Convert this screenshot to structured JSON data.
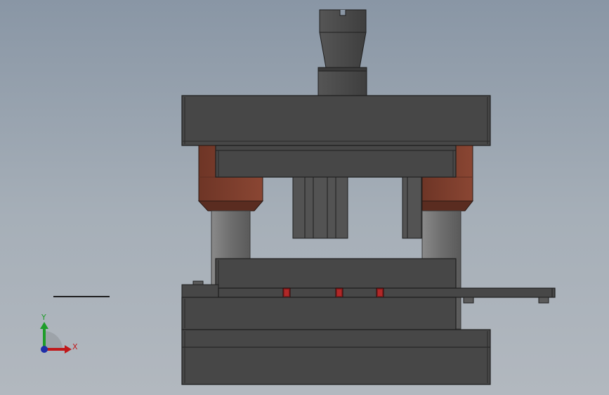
{
  "viewport": {
    "background_top": "#8996a5",
    "background_bottom": "#b2b8bf"
  },
  "colors": {
    "steel_dark": "#464646",
    "steel_mid": "#5a5a5a",
    "edge": "#1e1e1e",
    "bushing": "#7a3e2e",
    "bushing_dark": "#5a2c20",
    "pillar": "#7e7e7e",
    "red_pin": "#8a1c1c",
    "axis_x": "#c0181a",
    "axis_y": "#1f9d2a",
    "axis_z": "#1f2ea8"
  },
  "triad": {
    "x_label": "X",
    "y_label": "Y"
  }
}
